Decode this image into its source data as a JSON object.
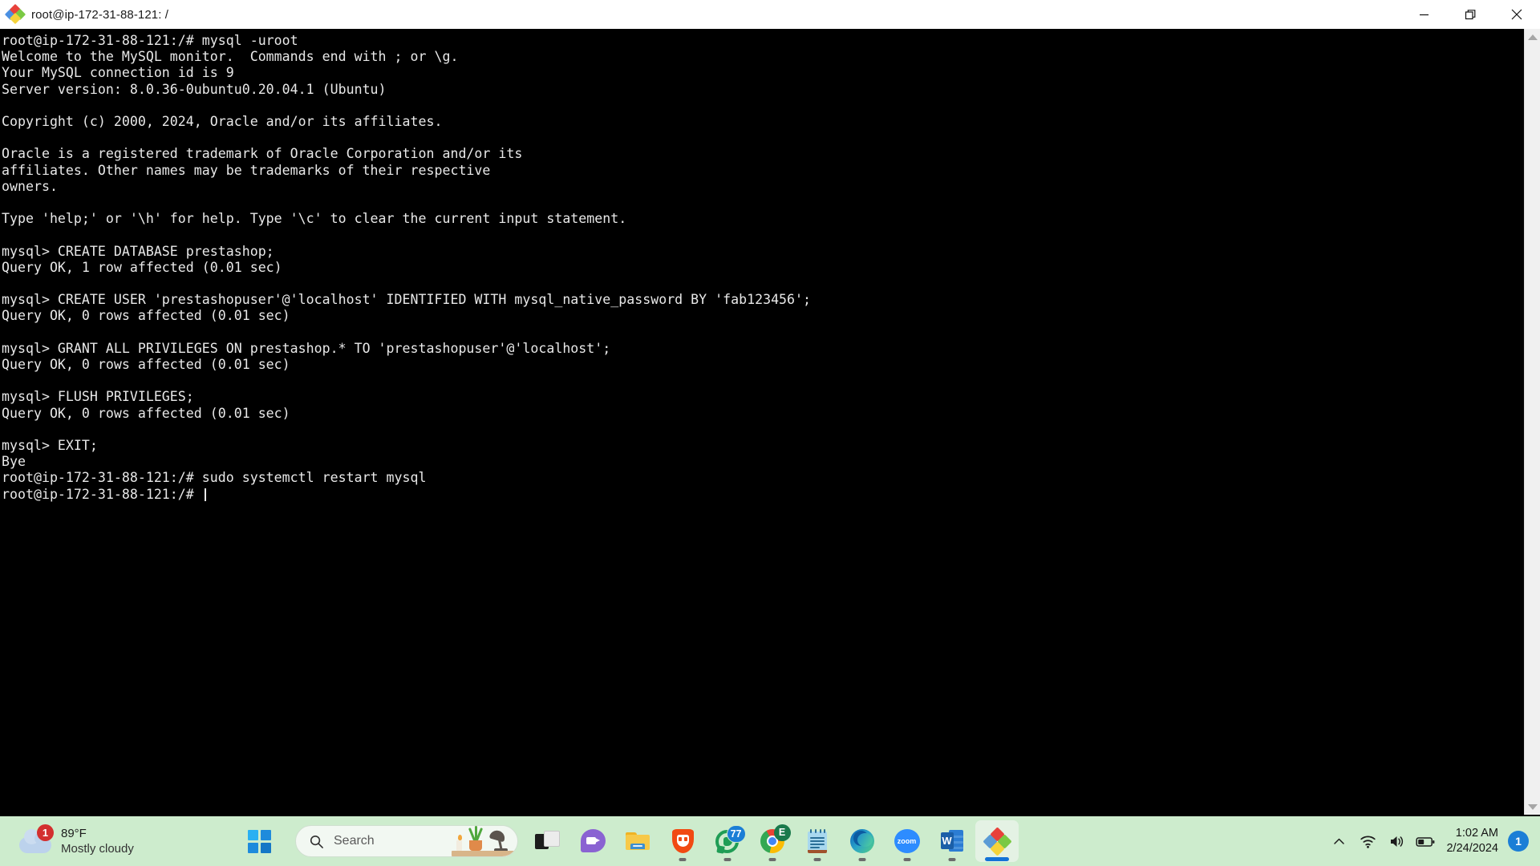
{
  "window": {
    "title": "root@ip-172-31-88-121: /",
    "app_icon": "mobaxterm-diamond-icon",
    "controls": {
      "minimize": "minimize-icon",
      "restore": "restore-icon",
      "close": "close-icon"
    }
  },
  "terminal": {
    "lines": [
      "root@ip-172-31-88-121:/# mysql -uroot",
      "Welcome to the MySQL monitor.  Commands end with ; or \\g.",
      "Your MySQL connection id is 9",
      "Server version: 8.0.36-0ubuntu0.20.04.1 (Ubuntu)",
      "",
      "Copyright (c) 2000, 2024, Oracle and/or its affiliates.",
      "",
      "Oracle is a registered trademark of Oracle Corporation and/or its",
      "affiliates. Other names may be trademarks of their respective",
      "owners.",
      "",
      "Type 'help;' or '\\h' for help. Type '\\c' to clear the current input statement.",
      "",
      "mysql> CREATE DATABASE prestashop;",
      "Query OK, 1 row affected (0.01 sec)",
      "",
      "mysql> CREATE USER 'prestashopuser'@'localhost' IDENTIFIED WITH mysql_native_password BY 'fab123456';",
      "Query OK, 0 rows affected (0.01 sec)",
      "",
      "mysql> GRANT ALL PRIVILEGES ON prestashop.* TO 'prestashopuser'@'localhost';",
      "Query OK, 0 rows affected (0.01 sec)",
      "",
      "mysql> FLUSH PRIVILEGES;",
      "Query OK, 0 rows affected (0.01 sec)",
      "",
      "mysql> EXIT;",
      "Bye",
      "root@ip-172-31-88-121:/# sudo systemctl restart mysql",
      "root@ip-172-31-88-121:/# "
    ],
    "colors": {
      "background": "#000000",
      "foreground": "#e8e8e8"
    }
  },
  "scrollbar": {
    "up_arrow": "scroll-up-arrow-icon",
    "down_arrow": "scroll-down-arrow-icon"
  },
  "taskbar": {
    "background": "#cdeccd",
    "weather": {
      "icon": "cloud-icon",
      "badge": "1",
      "temperature": "89°F",
      "condition": "Mostly cloudy"
    },
    "start": {
      "label": "Start",
      "icon": "windows-logo-icon"
    },
    "search": {
      "icon": "search-icon",
      "placeholder": "Search",
      "value": ""
    },
    "apps": [
      {
        "name": "task-view",
        "icon": "task-view-icon",
        "running": false,
        "badge": ""
      },
      {
        "name": "chat",
        "icon": "chat-video-icon",
        "running": false,
        "badge": ""
      },
      {
        "name": "file-explorer",
        "icon": "file-explorer-icon",
        "running": false,
        "badge": ""
      },
      {
        "name": "brave-browser",
        "icon": "brave-lion-icon",
        "running": true,
        "badge": ""
      },
      {
        "name": "whatsapp",
        "icon": "whatsapp-icon",
        "running": true,
        "badge": "77"
      },
      {
        "name": "google-chrome",
        "icon": "chrome-icon",
        "running": true,
        "badge": "E"
      },
      {
        "name": "notepad",
        "icon": "notepad-icon",
        "running": true,
        "badge": ""
      },
      {
        "name": "microsoft-edge",
        "icon": "edge-icon",
        "running": true,
        "badge": ""
      },
      {
        "name": "zoom",
        "icon": "zoom-icon",
        "running": true,
        "badge": "",
        "label": "zoom"
      },
      {
        "name": "microsoft-word",
        "icon": "word-icon",
        "running": true,
        "badge": "",
        "label": "W"
      },
      {
        "name": "mobaxterm",
        "icon": "mobaxterm-diamond-icon",
        "running": true,
        "badge": "",
        "active": true
      }
    ],
    "tray": {
      "overflow": "chevron-up-icon",
      "wifi": "wifi-icon",
      "volume": "speaker-icon",
      "battery": "battery-icon",
      "time": "1:02 AM",
      "date": "2/24/2024",
      "notification_count": "1"
    }
  }
}
